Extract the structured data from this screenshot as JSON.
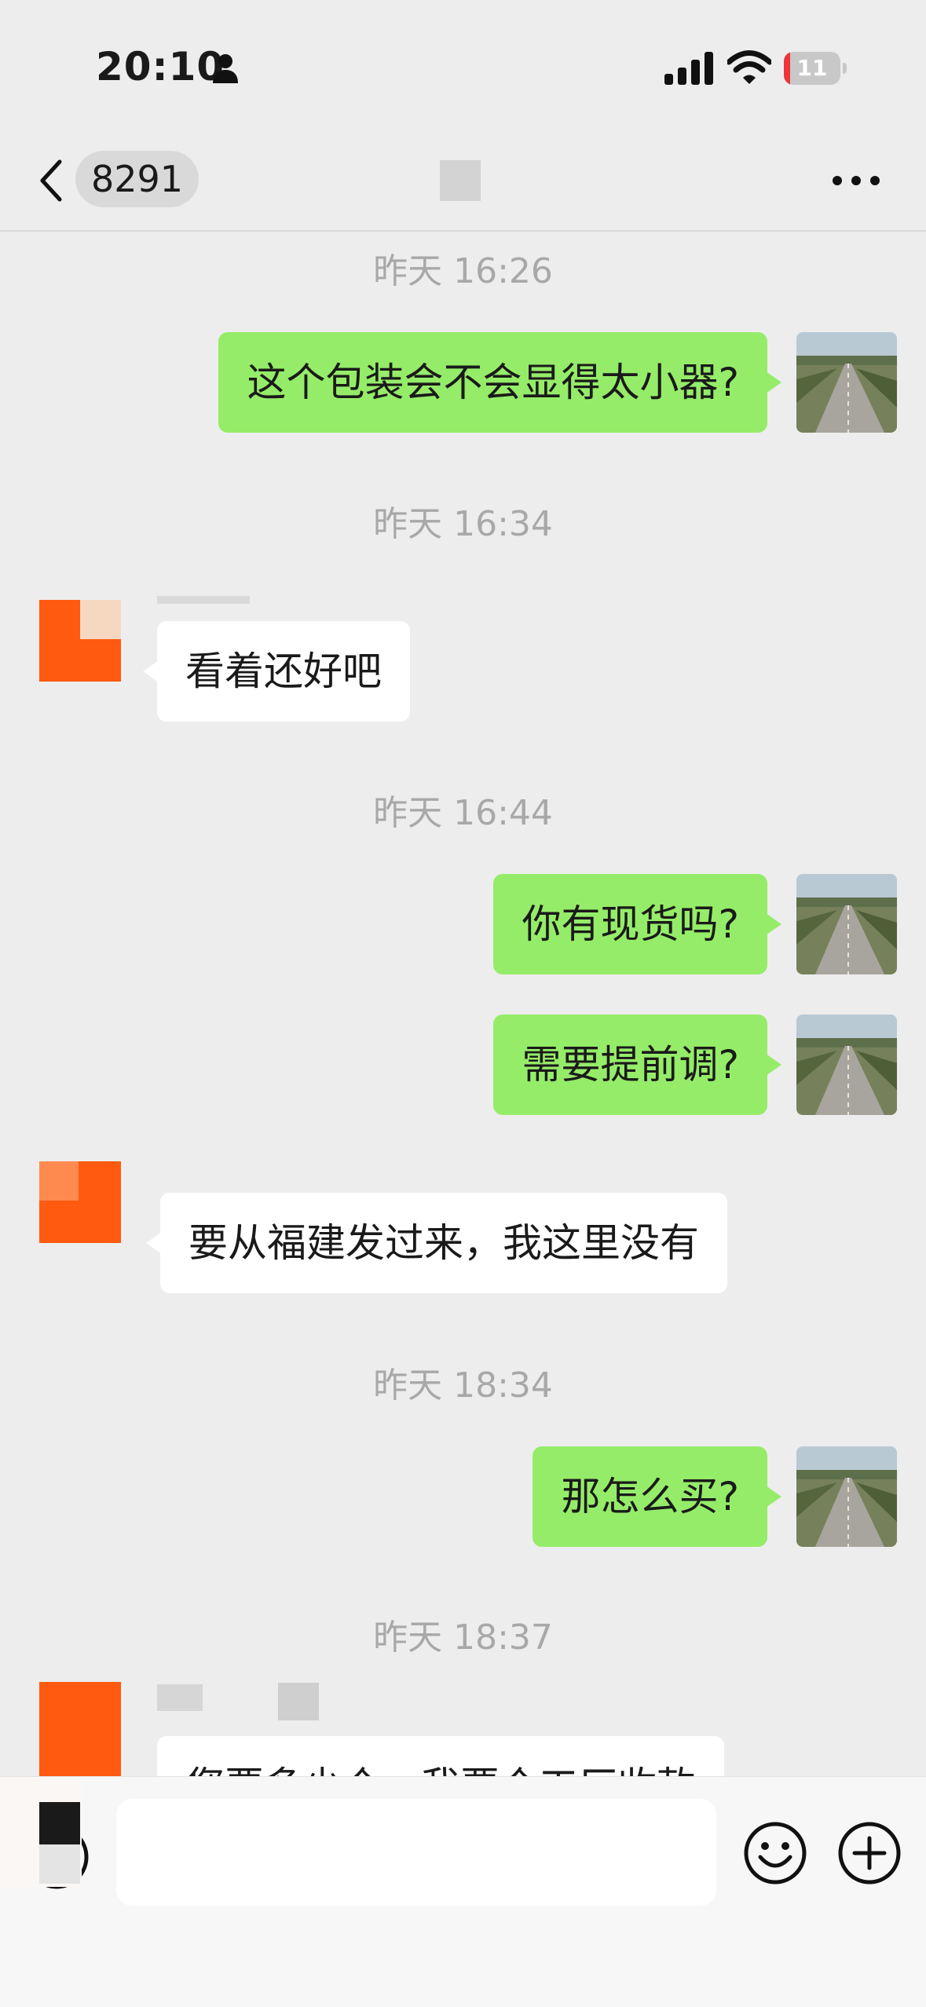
{
  "status_bar": {
    "time": "20:10",
    "battery_level": "11",
    "battery_fraction": 0.11,
    "battery_color": "#f0323a"
  },
  "nav": {
    "back_icon": "chevron-left-icon",
    "unread_count": "8291",
    "more_icon": "more-dots-icon"
  },
  "messages": [
    {
      "type": "time",
      "text": "昨天 16:26"
    },
    {
      "type": "out",
      "text": "这个包装会不会显得太小器?"
    },
    {
      "type": "time",
      "text": "昨天 16:34"
    },
    {
      "type": "in",
      "sender_name": "",
      "text": "看着还好吧"
    },
    {
      "type": "time",
      "text": "昨天 16:44"
    },
    {
      "type": "out",
      "text": "你有现货吗?"
    },
    {
      "type": "out",
      "text": "需要提前调?"
    },
    {
      "type": "in",
      "sender_name": "",
      "text": "要从福建发过来，我这里没有"
    },
    {
      "type": "time",
      "text": "昨天 18:34"
    },
    {
      "type": "out",
      "text": "那怎么买?"
    },
    {
      "type": "time",
      "text": "昨天 18:37"
    },
    {
      "type": "in",
      "sender_name": "",
      "text": "您要多少个，我要个工厂收款"
    }
  ],
  "colors": {
    "background": "#ededed",
    "bubble_out": "#95ec69",
    "bubble_in": "#ffffff",
    "peer_avatar": "#ff5a10"
  },
  "input_bar": {
    "placeholder": "",
    "voice_icon": "voice-icon",
    "emoji_icon": "emoji-icon",
    "plus_icon": "plus-icon"
  }
}
